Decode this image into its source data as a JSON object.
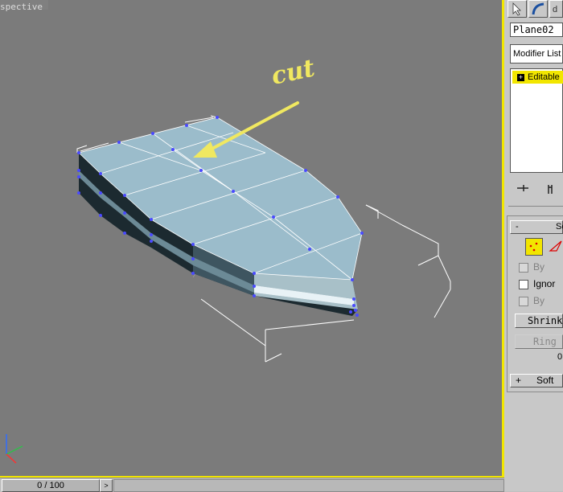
{
  "viewport": {
    "label": "spective",
    "annotation": "cut"
  },
  "timeline": {
    "counter": "0 / 100",
    "next_arrow": ">"
  },
  "command_panel": {
    "object_name": "Plane02",
    "modifier_list": "Modifier List",
    "stack_item": "Editable",
    "stack_item_sign": "+",
    "pin_icon": "pin-stack-icon",
    "graph_icon": "show-end-result-icon",
    "selection_rollout": {
      "sign": "-",
      "label": "Se"
    },
    "checkbox_by_vertex": "By",
    "checkbox_ignore": "Ignor",
    "checkbox_by_angle": "By",
    "shrink_button": "Shrink",
    "ring_button": "Ring",
    "selected_count": "0",
    "soft_rollout": {
      "sign": "+",
      "label": "Soft"
    }
  },
  "colors": {
    "viewport_bg": "#7b7b7b",
    "active_border": "#f2e600",
    "annotation": "#f0e860",
    "mesh_top": "#9bbccb",
    "mesh_side": "#1c2a30",
    "vertex": "#4a4aff"
  }
}
